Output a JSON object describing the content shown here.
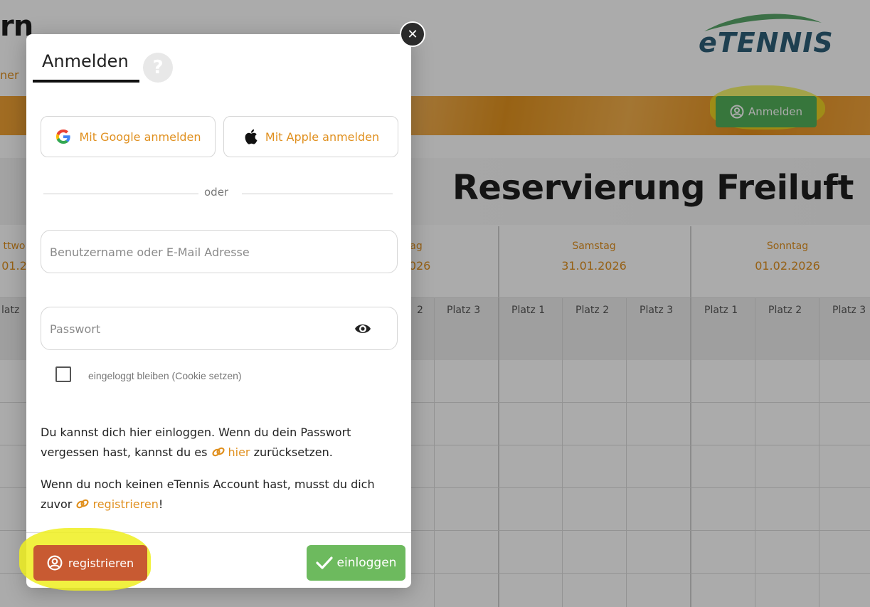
{
  "background": {
    "page_title_fragment": "rn",
    "page_sub_fragment": "ner",
    "logo_text": "eTENNIS",
    "header_login_label": "Anmelden",
    "heading": "Reservierung Freiluft",
    "days": [
      {
        "name": "ttwo",
        "date": "01.2"
      },
      {
        "name": "ag",
        "date": "2026"
      },
      {
        "name": "Samstag",
        "date": "31.01.2026"
      },
      {
        "name": "Sonntag",
        "date": "01.02.2026"
      }
    ],
    "courts": [
      "latz",
      "2",
      "Platz 3",
      "Platz 1",
      "Platz 2",
      "Platz 3",
      "Platz 1",
      "Platz 2",
      "Platz 3"
    ]
  },
  "modal": {
    "title": "Anmelden",
    "help_symbol": "?",
    "close_symbol": "✕",
    "google_label": "Mit Google anmelden",
    "apple_label": "Mit Apple anmelden",
    "divider_text": "oder",
    "username_placeholder": "Benutzername oder E-Mail Adresse",
    "password_placeholder": "Passwort",
    "remember_label": "eingeloggt bleiben (Cookie setzen)",
    "info1_prefix": "Du kannst dich hier einloggen. Wenn du dein Passwort vergessen hast, kannst du es ",
    "info1_link": "hier",
    "info1_suffix": " zurücksetzen.",
    "info2_prefix": "Wenn du noch keinen eTennis Account hast, musst du dich zuvor ",
    "info2_link": "registrieren",
    "info2_suffix": "!",
    "register_label": "registrieren",
    "login_label": "einloggen"
  },
  "colors": {
    "accent_orange": "#e0901f",
    "register_red": "#c85a32",
    "login_green": "#6dba5e",
    "highlight_yellow": "#eeee1e",
    "logo_blue": "#2e5f78"
  }
}
